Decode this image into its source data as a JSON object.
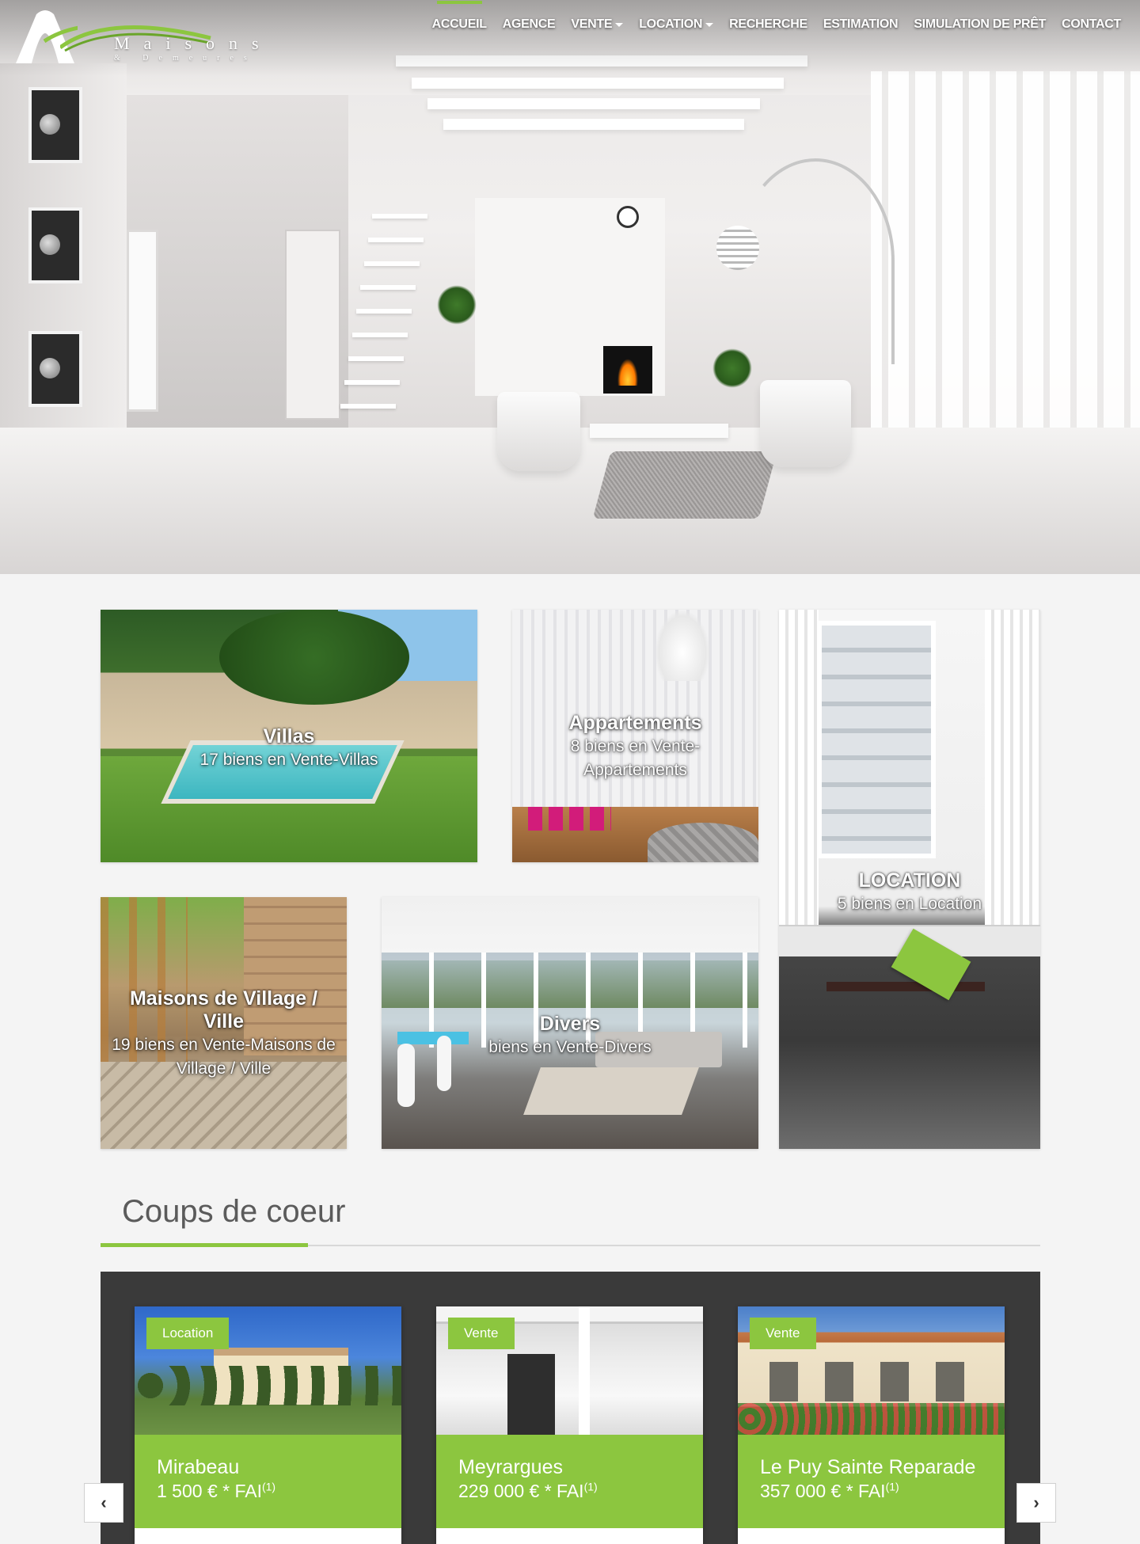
{
  "brand": {
    "name_line1": "Maisons",
    "name_line2": "& Demeures",
    "accent_color": "#8cc63f"
  },
  "nav": {
    "items": [
      {
        "label": "ACCUEIL",
        "active": true,
        "dropdown": false
      },
      {
        "label": "AGENCE",
        "active": false,
        "dropdown": false
      },
      {
        "label": "VENTE",
        "active": false,
        "dropdown": true
      },
      {
        "label": "LOCATION",
        "active": false,
        "dropdown": true
      },
      {
        "label": "RECHERCHE",
        "active": false,
        "dropdown": false
      },
      {
        "label": "ESTIMATION",
        "active": false,
        "dropdown": false
      },
      {
        "label": "SIMULATION DE PRÊT",
        "active": false,
        "dropdown": false
      },
      {
        "label": "CONTACT",
        "active": false,
        "dropdown": false
      }
    ]
  },
  "categories": {
    "villas": {
      "title": "Villas",
      "subtitle": "17 biens en Vente-Villas"
    },
    "appartements": {
      "title": "Appartements",
      "subtitle": "8 biens en Vente-Appartements"
    },
    "location": {
      "title": "LOCATION",
      "subtitle": "5 biens en Location"
    },
    "village": {
      "title": "Maisons de Village / Ville",
      "subtitle": "19 biens en Vente-Maisons de Village / Ville"
    },
    "divers": {
      "title": "Divers",
      "subtitle": "biens en Vente-Divers"
    }
  },
  "featured": {
    "title": "Coups de coeur",
    "cards": [
      {
        "badge": "Location",
        "city": "Mirabeau",
        "price": "1 500 € * FAI",
        "note": "(1)"
      },
      {
        "badge": "Vente",
        "city": "Meyrargues",
        "price": "229 000 € * FAI",
        "note": "(1)"
      },
      {
        "badge": "Vente",
        "city": "Le Puy Sainte Reparade",
        "price": "357 000 € * FAI",
        "note": "(1)"
      }
    ],
    "prev_icon": "chevron-left-icon",
    "next_icon": "chevron-right-icon",
    "prev_glyph": "‹",
    "next_glyph": "›"
  }
}
